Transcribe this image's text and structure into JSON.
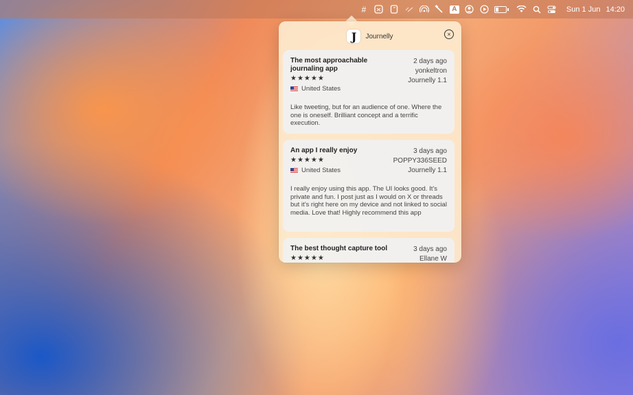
{
  "menubar": {
    "icons": [
      "hash-icon",
      "app-icon-2",
      "app-icon-3",
      "app-icon-4",
      "airdrop-icon",
      "tool-icon",
      "keyboard-input-icon",
      "user-icon",
      "play-icon",
      "battery-icon",
      "wifi-icon",
      "search-icon",
      "control-center-icon"
    ],
    "hash": "#",
    "input_letter": "A",
    "date": "Sun 1 Jun",
    "time": "14:20"
  },
  "popover": {
    "app_letter": "J",
    "app_name": "Journelly",
    "close": "×"
  },
  "reviews": [
    {
      "title": "The most approachable journaling app",
      "time": "2 days ago",
      "author": "yonkeltron",
      "version": "Journelly 1.1",
      "stars": "★★★★★",
      "country": "United States",
      "body": "Like tweeting, but for an audience of one. Where the one is oneself. Brilliant concept and a terrific execution."
    },
    {
      "title": "An app I really enjoy",
      "time": "3 days ago",
      "author": "POPPY336SEED",
      "version": "Journelly 1.1",
      "stars": "★★★★★",
      "country": "United States",
      "body": "I really enjoy using this app. The UI looks good. It’s private and fun. I post just as I would on X or threads but it’s right here on my device and not linked to social media. Love that! Highly recommend this app"
    },
    {
      "title": "The best thought capture tool",
      "time": "3 days ago",
      "author": "Ellane W",
      "stars": "★★★★★"
    }
  ]
}
